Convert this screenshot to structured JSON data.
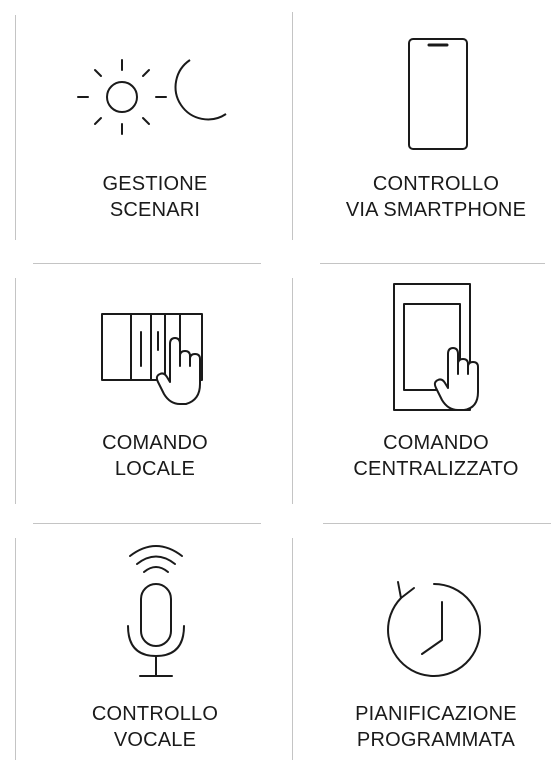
{
  "features": [
    {
      "icon": "sun-moon-icon",
      "line1": "GESTIONE",
      "line2": "SCENARI"
    },
    {
      "icon": "smartphone-icon",
      "line1": "CONTROLLO",
      "line2": "VIA SMARTPHONE"
    },
    {
      "icon": "wall-switch-touch-icon",
      "line1": "COMANDO",
      "line2": "LOCALE"
    },
    {
      "icon": "tablet-touch-icon",
      "line1": "COMANDO",
      "line2": "CENTRALIZZATO"
    },
    {
      "icon": "voice-microphone-icon",
      "line1": "CONTROLLO",
      "line2": "VOCALE"
    },
    {
      "icon": "clock-timer-icon",
      "line1": "PIANIFICAZIONE",
      "line2": "PROGRAMMATA"
    }
  ]
}
